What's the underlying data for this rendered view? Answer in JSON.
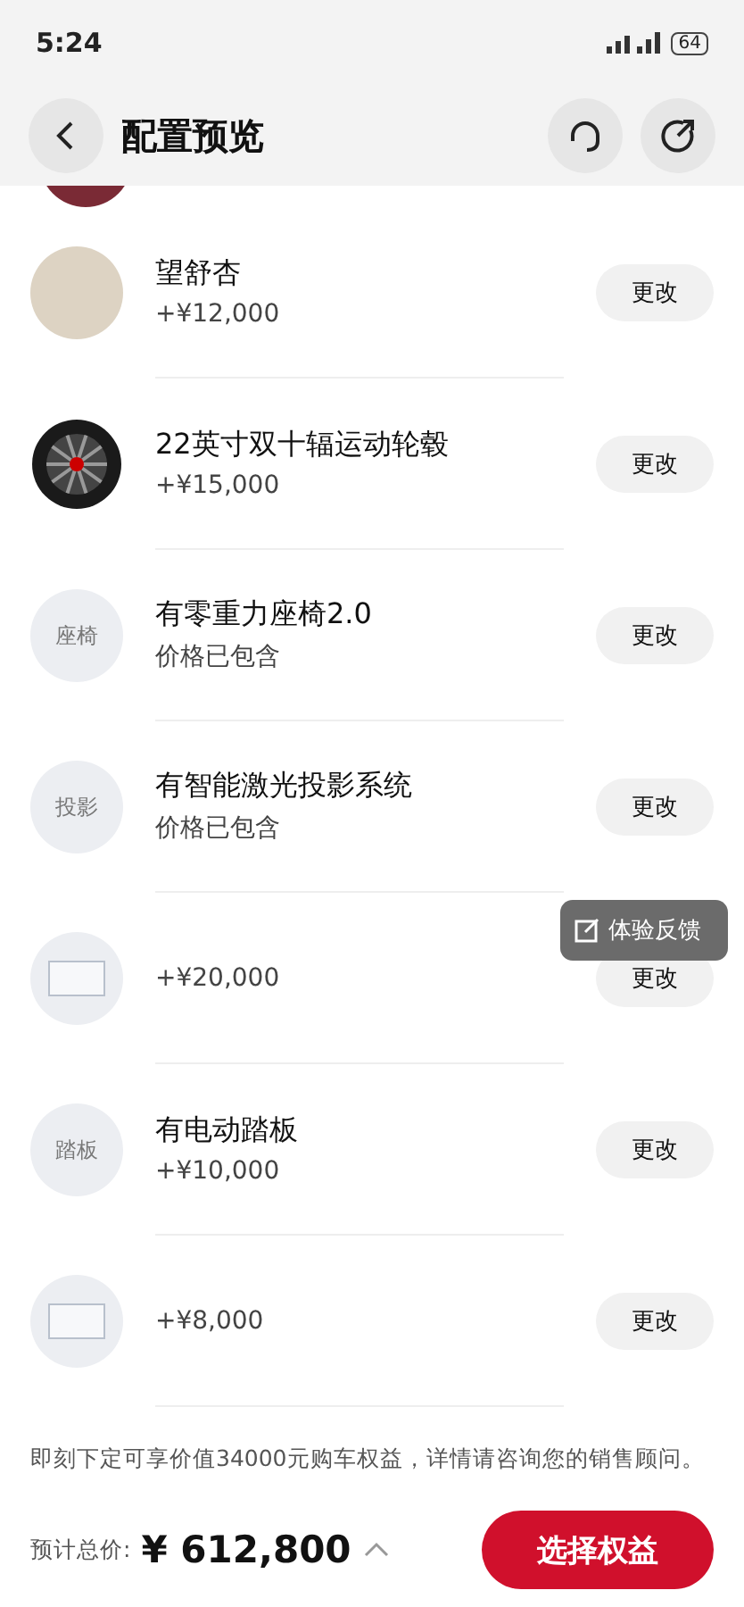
{
  "status_bar": {
    "time": "5:24",
    "battery": "64"
  },
  "header": {
    "title": "配置预览"
  },
  "peek": {
    "kind": "swatch",
    "color": "#7a2a35"
  },
  "options": [
    {
      "icon": {
        "kind": "swatch",
        "color": "#ddd3c3"
      },
      "name": "望舒杏",
      "price": "+¥12,000",
      "button": "更改"
    },
    {
      "icon": {
        "kind": "wheel"
      },
      "name": "22英寸双十辐运动轮毂",
      "price": "+¥15,000",
      "button": "更改"
    },
    {
      "icon": {
        "kind": "label",
        "text": "座椅"
      },
      "name": "有零重力座椅2.0",
      "price": "价格已包含",
      "button": "更改"
    },
    {
      "icon": {
        "kind": "label",
        "text": "投影"
      },
      "name": "有智能激光投影系统",
      "price": "价格已包含",
      "button": "更改"
    },
    {
      "icon": {
        "kind": "tag"
      },
      "price": "+¥20,000",
      "button": "更改"
    },
    {
      "icon": {
        "kind": "label",
        "text": "踏板"
      },
      "name": "有电动踏板",
      "price": "+¥10,000",
      "button": "更改"
    },
    {
      "icon": {
        "kind": "tag"
      },
      "price": "+¥8,000",
      "button": "更改"
    }
  ],
  "feedback": {
    "label": "体验反馈"
  },
  "note": "即刻下定可享价值34000元购车权益，详情请咨询您的销售顾问。",
  "footer": {
    "total_label": "预计总价:",
    "total": "¥ 612,800",
    "action": "选择权益"
  }
}
